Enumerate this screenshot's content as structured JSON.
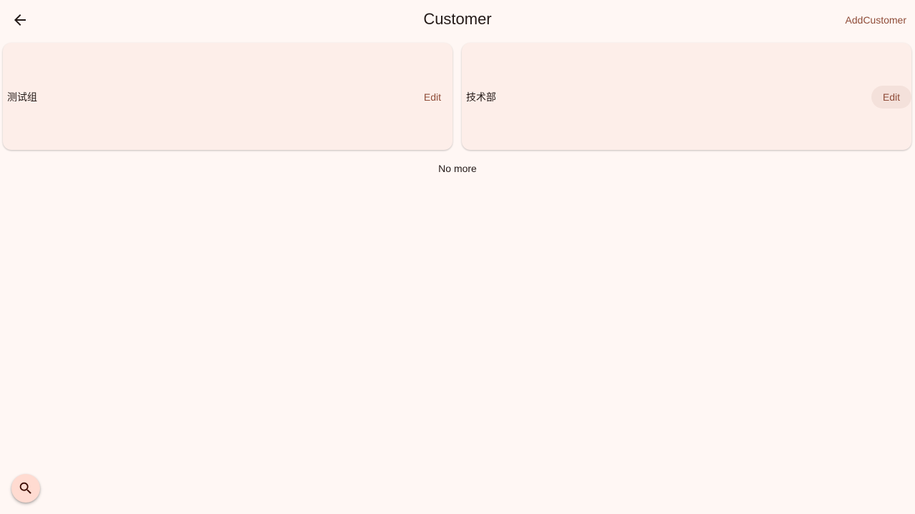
{
  "appbar": {
    "title": "Customer",
    "back_icon": "arrow-back-icon",
    "add_label": "AddCustomer"
  },
  "customers": [
    {
      "name": "测试组",
      "edit_label": "Edit"
    },
    {
      "name": "技术部",
      "edit_label": "Edit"
    }
  ],
  "list_footer": "No more",
  "fab": {
    "icon": "search-icon"
  },
  "colors": {
    "background": "#fff7f4",
    "card": "#fdeee9",
    "accent": "#8f4c38",
    "fab": "#ffdbd1"
  }
}
